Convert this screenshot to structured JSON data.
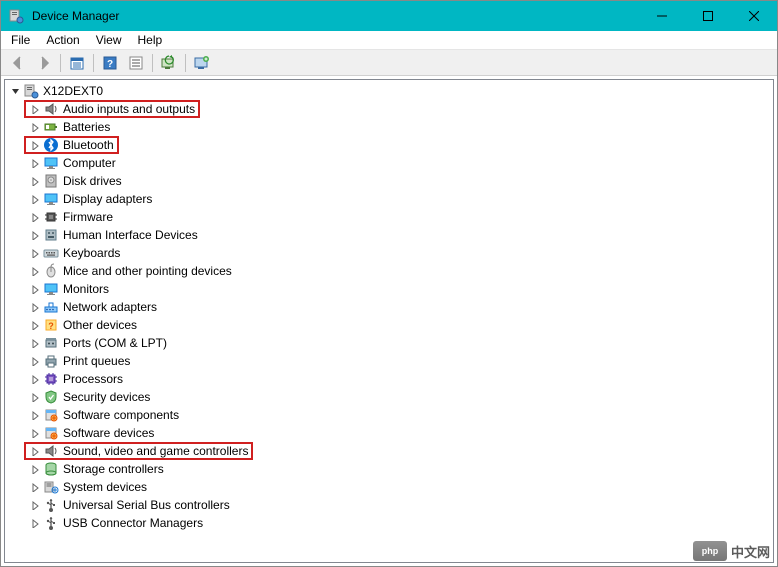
{
  "window": {
    "title": "Device Manager"
  },
  "menubar": {
    "items": [
      "File",
      "Action",
      "View",
      "Help"
    ]
  },
  "toolbar": {
    "buttons": [
      {
        "name": "back-button",
        "icon": "arrow-left",
        "disabled": true
      },
      {
        "name": "forward-button",
        "icon": "arrow-right",
        "disabled": true
      },
      {
        "sep": true
      },
      {
        "name": "show-hide-tree-button",
        "icon": "calendar-box"
      },
      {
        "sep": true
      },
      {
        "name": "help-button",
        "icon": "help-box"
      },
      {
        "name": "properties-button",
        "icon": "list-box"
      },
      {
        "sep": true
      },
      {
        "name": "scan-hardware-button",
        "icon": "refresh-monitor"
      },
      {
        "sep": true
      },
      {
        "name": "add-legacy-hardware-button",
        "icon": "monitor-plus"
      }
    ]
  },
  "tree": {
    "root": {
      "label": "X12DEXT0",
      "icon": "computer-root",
      "expanded": true
    },
    "categories": [
      {
        "label": "Audio inputs and outputs",
        "icon": "speaker",
        "highlighted": true
      },
      {
        "label": "Batteries",
        "icon": "battery"
      },
      {
        "label": "Bluetooth",
        "icon": "bluetooth",
        "highlighted": true
      },
      {
        "label": "Computer",
        "icon": "monitor"
      },
      {
        "label": "Disk drives",
        "icon": "disk"
      },
      {
        "label": "Display adapters",
        "icon": "monitor"
      },
      {
        "label": "Firmware",
        "icon": "chip"
      },
      {
        "label": "Human Interface Devices",
        "icon": "hid"
      },
      {
        "label": "Keyboards",
        "icon": "keyboard"
      },
      {
        "label": "Mice and other pointing devices",
        "icon": "mouse"
      },
      {
        "label": "Monitors",
        "icon": "monitor"
      },
      {
        "label": "Network adapters",
        "icon": "network"
      },
      {
        "label": "Other devices",
        "icon": "other"
      },
      {
        "label": "Ports (COM & LPT)",
        "icon": "port"
      },
      {
        "label": "Print queues",
        "icon": "printer"
      },
      {
        "label": "Processors",
        "icon": "cpu"
      },
      {
        "label": "Security devices",
        "icon": "security"
      },
      {
        "label": "Software components",
        "icon": "software"
      },
      {
        "label": "Software devices",
        "icon": "software"
      },
      {
        "label": "Sound, video and game controllers",
        "icon": "speaker",
        "highlighted": true
      },
      {
        "label": "Storage controllers",
        "icon": "storage"
      },
      {
        "label": "System devices",
        "icon": "system"
      },
      {
        "label": "Universal Serial Bus controllers",
        "icon": "usb"
      },
      {
        "label": "USB Connector Managers",
        "icon": "usb"
      }
    ]
  },
  "watermark": {
    "logo": "php",
    "text": "中文网"
  }
}
